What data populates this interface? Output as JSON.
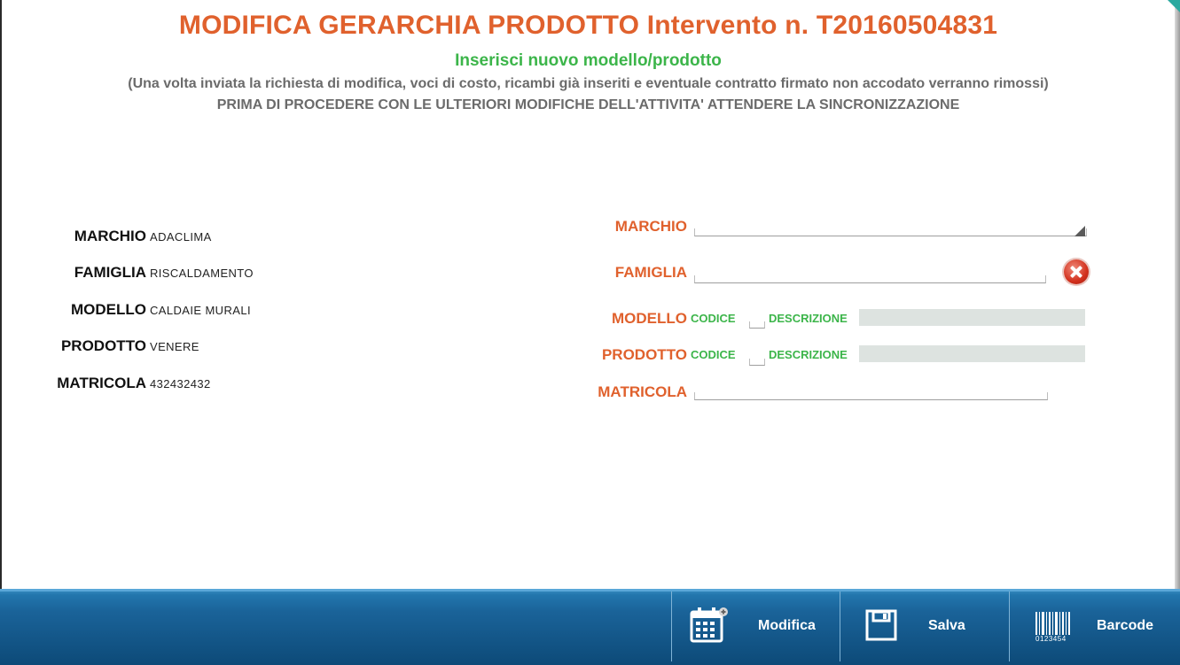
{
  "header": {
    "title": "MODIFICA GERARCHIA PRODOTTO Intervento n.  T20160504831",
    "subtitle": "Inserisci nuovo modello/prodotto",
    "notice_1": "(Una volta inviata la richiesta di modifica, voci di costo, ricambi già inseriti e eventuale contratto firmato non accodato verranno rimossi)",
    "notice_2": "PRIMA DI PROCEDERE CON LE ULTERIORI MODIFICHE DELL'ATTIVITA' ATTENDERE LA SINCRONIZZAZIONE"
  },
  "current": {
    "rows": [
      {
        "label": "MARCHIO",
        "value": "ADACLIMA"
      },
      {
        "label": "FAMIGLIA",
        "value": "RISCALDAMENTO"
      },
      {
        "label": "MODELLO",
        "value": "CALDAIE MURALI"
      },
      {
        "label": "PRODOTTO",
        "value": "VENERE"
      },
      {
        "label": "MATRICOLA",
        "value": "432432432"
      }
    ]
  },
  "form": {
    "marchio_label": "MARCHIO",
    "marchio_value": "",
    "famiglia_label": "FAMIGLIA",
    "famiglia_value": "",
    "modello_label": "MODELLO",
    "prodotto_label": "PRODOTTO",
    "matricola_label": "MATRICOLA",
    "matricola_value": "",
    "codice_label": "CODICE",
    "descrizione_label": "DESCRIZIONE",
    "modello_codice": "",
    "modello_descrizione": "",
    "prodotto_codice": "",
    "prodotto_descrizione": ""
  },
  "toolbar": {
    "modifica_label": "Modifica",
    "salva_label": "Salva",
    "barcode_label": "Barcode",
    "barcode_digits": "0123454"
  },
  "colors": {
    "accent_orange": "#e0612d",
    "accent_green": "#3cb54a",
    "toolbar_blue": "#1a6399"
  }
}
